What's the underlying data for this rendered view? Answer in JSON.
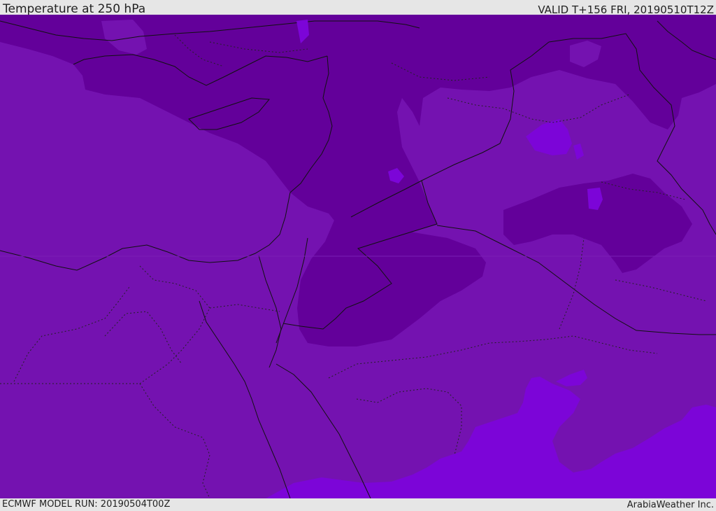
{
  "header": {
    "title": "Temperature at 250 hPa",
    "valid": "VALID T+156 FRI, 20190510T12Z"
  },
  "footer": {
    "model_run": "ECMWF MODEL RUN: 20190504T00Z",
    "credit": "ArabiaWeather Inc."
  },
  "colors": {
    "base": "#7412b0",
    "cold": "#63009a",
    "warm": "#7c05d8",
    "border": "#111111"
  }
}
